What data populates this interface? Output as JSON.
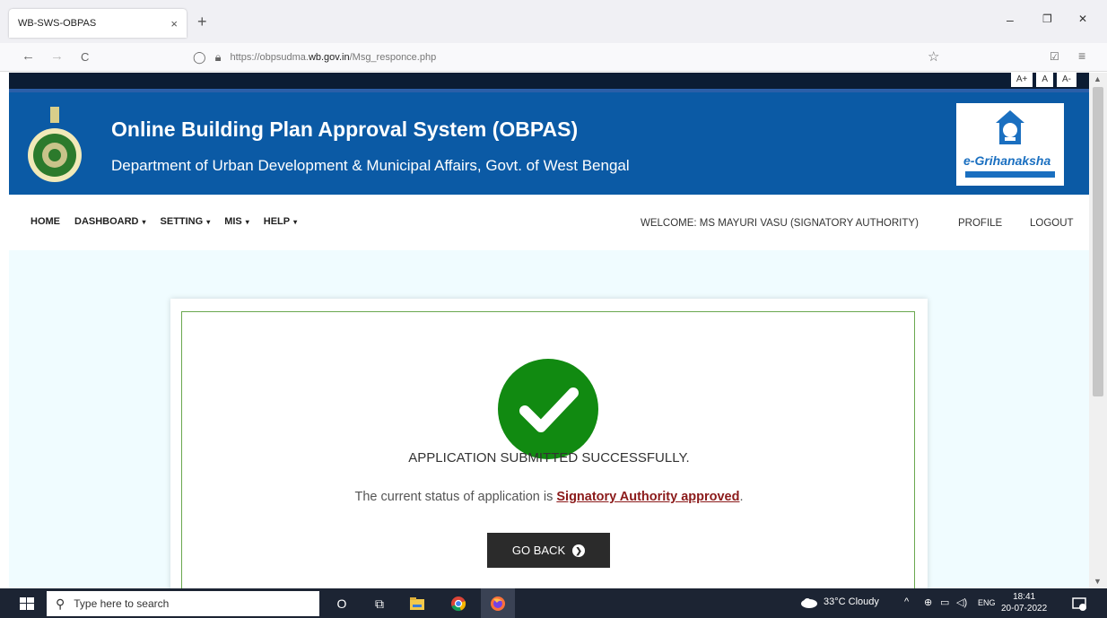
{
  "browser": {
    "tab_title": "WB-SWS-OBPAS",
    "tab_close": "×",
    "new_tab": "+",
    "minimize": "–",
    "maximize": "❐",
    "close": "✕",
    "back": "←",
    "forward": "→",
    "reload": "C",
    "url_prefix": "https://obpsudma.",
    "url_domain": "wb.gov.in",
    "url_path": "/Msg_responce.php",
    "star": "☆",
    "pocket": "☑",
    "menu": "≡"
  },
  "site": {
    "font_buttons": [
      "A+",
      "A",
      "A-"
    ],
    "title": "Online Building Plan Approval System (OBPAS)",
    "subtitle": "Department of Urban Development & Municipal Affairs, Govt. of West Bengal",
    "logo_text": "e-Grihanaksha"
  },
  "menu": {
    "home": "HOME",
    "dashboard": "DASHBOARD",
    "setting": "SETTING",
    "mis": "MIS",
    "help": "HELP",
    "caret": "▾",
    "welcome": "WELCOME: MS MAYURI VASU (SIGNATORY AUTHORITY)",
    "profile": "PROFILE",
    "logout": "LOGOUT"
  },
  "message": {
    "success": "APPLICATION SUBMITTED SUCCESSFULLY.",
    "status_prefix": "The current status of application is ",
    "status_value": "Signatory Authority approved",
    "status_suffix": ".",
    "go_back": "GO BACK",
    "go_back_arrow": "❯"
  },
  "taskbar": {
    "search_placeholder": "Type here to search",
    "search_glyph": "⚲",
    "cortana": "O",
    "taskview": "⧉",
    "weather": "33°C  Cloudy",
    "tray_up": "^",
    "lang": "ENG",
    "time": "18:41",
    "date": "20-07-2022"
  },
  "colors": {
    "header_blue": "#0b5aa5",
    "status_red": "#8b1a1a",
    "success_green": "#118a11",
    "button_dark": "#2b2b2b"
  }
}
